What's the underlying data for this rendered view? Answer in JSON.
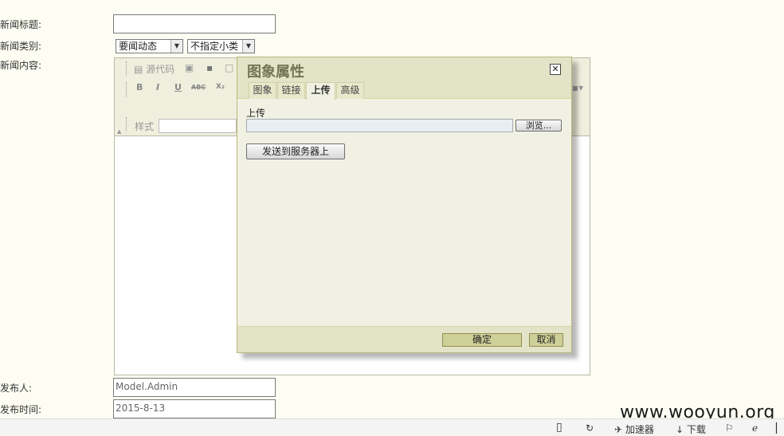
{
  "form": {
    "title_label": "新闻标题:",
    "category_label": "新闻类别:",
    "category_value": "要闻动态",
    "subcategory_value": "不指定小类",
    "content_label": "新闻内容:",
    "publisher_label": "发布人:",
    "publisher_value": "Model.Admin",
    "time_label": "发布时间:",
    "time_value": "2015-8-13"
  },
  "editor": {
    "source_label": "源代码",
    "style_label": "样式",
    "bold": "B",
    "italic": "I",
    "underline": "U",
    "strike": "ABC",
    "subscript": "X₂"
  },
  "dialog": {
    "title": "图象属性",
    "close_glyph": "✕",
    "tabs": [
      "图象",
      "链接",
      "上传",
      "高级"
    ],
    "active_tab": "上传",
    "upload_label": "上传",
    "browse_label": "浏览...",
    "send_label": "发送到服务器上",
    "ok_label": "确定",
    "cancel_label": "取消"
  },
  "statusbar": {
    "accelerator": "加速器",
    "download": "下载"
  },
  "watermark": "www.wooyun.org",
  "icons": [
    "phone-icon",
    "refresh-icon",
    "pin-icon",
    "download-arrow-icon",
    "flag-icon",
    "ie-icon",
    "close-icon"
  ]
}
